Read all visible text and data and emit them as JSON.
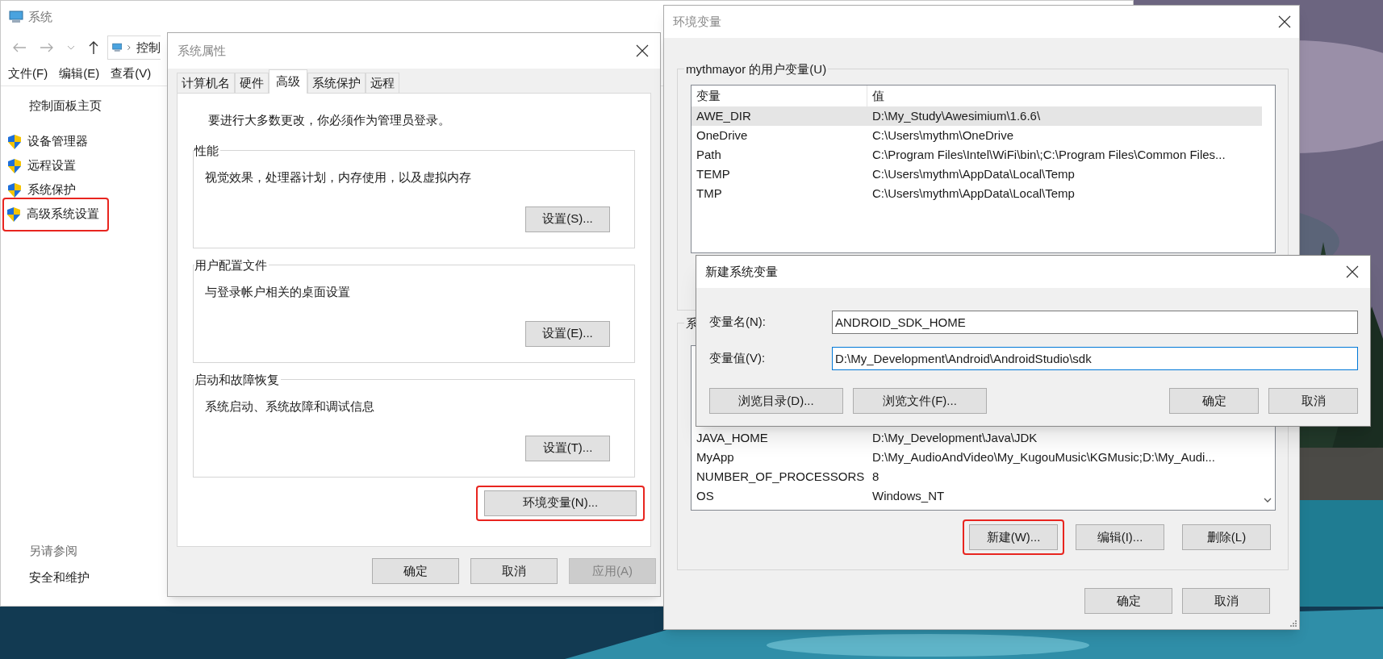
{
  "explorer": {
    "title": "系统",
    "address": "控制",
    "menu": [
      "文件(F)",
      "编辑(E)",
      "查看(V)"
    ],
    "sidebar": {
      "home": "控制面板主页",
      "items": [
        {
          "label": "设备管理器",
          "highlighted": false
        },
        {
          "label": "远程设置",
          "highlighted": false
        },
        {
          "label": "系统保护",
          "highlighted": false
        },
        {
          "label": "高级系统设置",
          "highlighted": true
        }
      ],
      "see_also_heading": "另请参阅",
      "see_also": [
        "安全和维护"
      ]
    }
  },
  "system_properties": {
    "title": "系统属性",
    "tabs": [
      {
        "label": "计算机名",
        "selected": false
      },
      {
        "label": "硬件",
        "selected": false
      },
      {
        "label": "高级",
        "selected": true
      },
      {
        "label": "系统保护",
        "selected": false
      },
      {
        "label": "远程",
        "selected": false
      }
    ],
    "admin_note": "要进行大多数更改，你必须作为管理员登录。",
    "groups": [
      {
        "title": "性能",
        "description": "视觉效果，处理器计划，内存使用，以及虚拟内存",
        "button": "设置(S)..."
      },
      {
        "title": "用户配置文件",
        "description": "与登录帐户相关的桌面设置",
        "button": "设置(E)..."
      },
      {
        "title": "启动和故障恢复",
        "description": "系统启动、系统故障和调试信息",
        "button": "设置(T)..."
      }
    ],
    "env_button": {
      "label": "环境变量(N)...",
      "highlighted": true
    },
    "buttons": [
      {
        "label": "确定",
        "disabled": false
      },
      {
        "label": "取消",
        "disabled": false
      },
      {
        "label": "应用(A)",
        "disabled": true
      }
    ]
  },
  "environment_variables": {
    "title": "环境变量",
    "user_group": "mythmayor 的用户变量(U)",
    "user_table": {
      "columns": [
        "变量",
        "值"
      ],
      "rows": [
        {
          "cells": [
            "AWE_DIR",
            "D:\\My_Study\\Awesimium\\1.6.6\\"
          ],
          "selected": true
        },
        {
          "cells": [
            "OneDrive",
            "C:\\Users\\mythm\\OneDrive"
          ],
          "selected": false
        },
        {
          "cells": [
            "Path",
            "C:\\Program Files\\Intel\\WiFi\\bin\\;C:\\Program Files\\Common Files..."
          ],
          "selected": false
        },
        {
          "cells": [
            "TEMP",
            "C:\\Users\\mythm\\AppData\\Local\\Temp"
          ],
          "selected": false
        },
        {
          "cells": [
            "TMP",
            "C:\\Users\\mythm\\AppData\\Local\\Temp"
          ],
          "selected": false
        }
      ]
    },
    "system_group": "系",
    "system_table": {
      "rows": [
        {
          "cells": [
            "JAVA_HOME",
            "D:\\My_Development\\Java\\JDK"
          ],
          "selected": false
        },
        {
          "cells": [
            "MyApp",
            "D:\\My_AudioAndVideo\\My_KugouMusic\\KGMusic;D:\\My_Audi..."
          ],
          "selected": false
        },
        {
          "cells": [
            "NUMBER_OF_PROCESSORS",
            "8"
          ],
          "selected": false
        },
        {
          "cells": [
            "OS",
            "Windows_NT"
          ],
          "selected": false
        }
      ]
    },
    "system_buttons": [
      {
        "label": "新建(W)...",
        "highlighted": true
      },
      {
        "label": "编辑(I)...",
        "highlighted": false
      },
      {
        "label": "删除(L)",
        "highlighted": false
      }
    ],
    "buttons": [
      "确定",
      "取消"
    ]
  },
  "new_variable_dialog": {
    "title": "新建系统变量",
    "fields": [
      {
        "label": "变量名(N):",
        "value": "ANDROID_SDK_HOME",
        "focused": false
      },
      {
        "label": "变量值(V):",
        "value": "D:\\My_Development\\Android\\AndroidStudio\\sdk",
        "focused": true
      }
    ],
    "browse_buttons": [
      "浏览目录(D)...",
      "浏览文件(F)..."
    ],
    "buttons": [
      "确定",
      "取消"
    ]
  }
}
